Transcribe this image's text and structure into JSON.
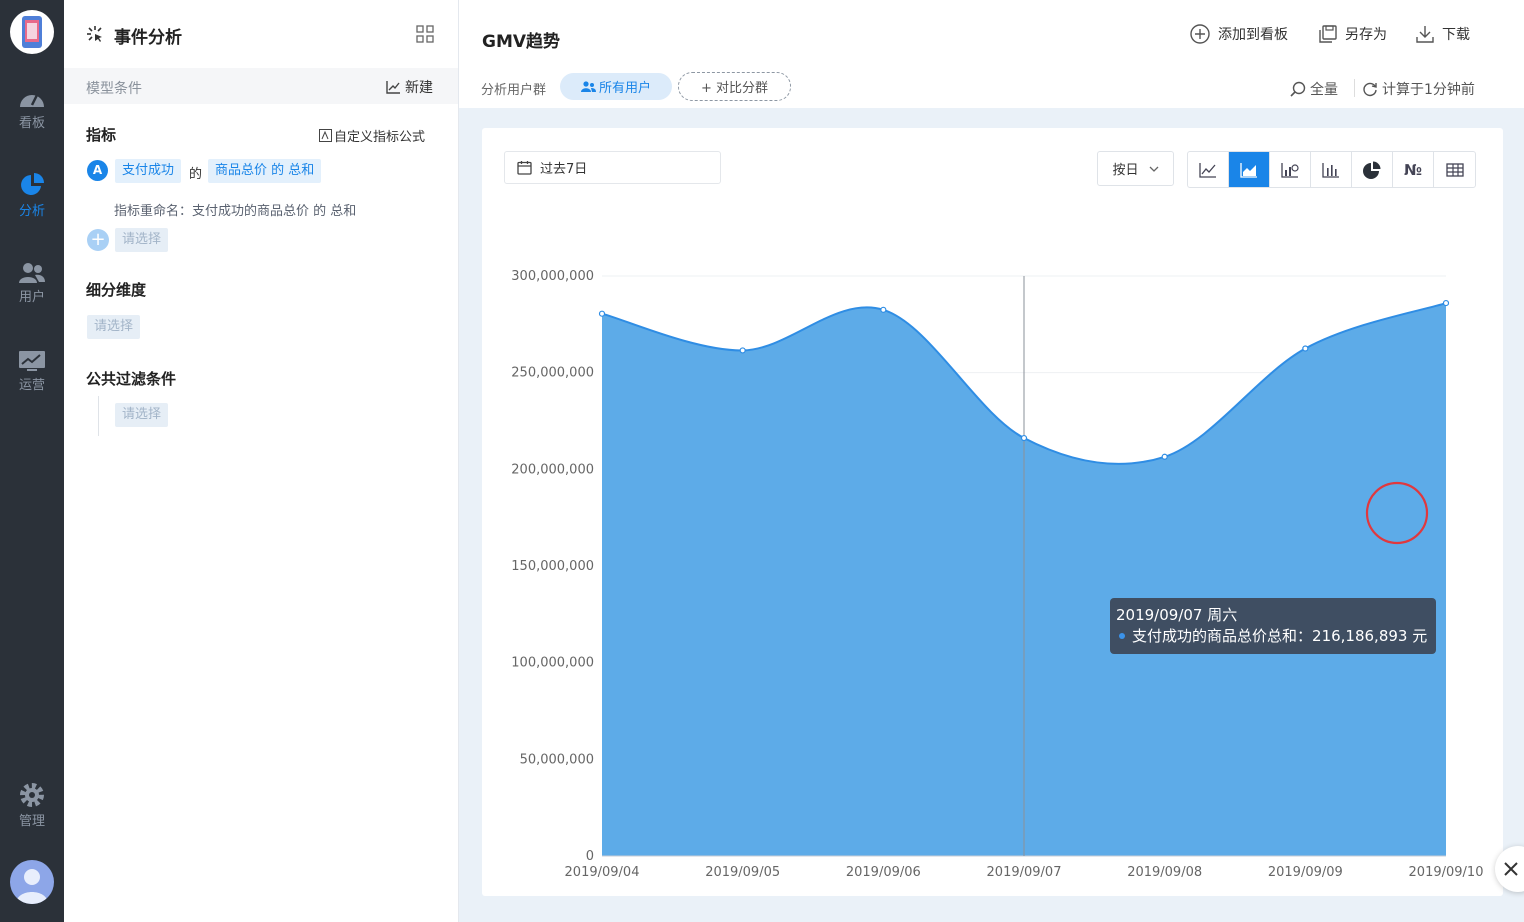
{
  "nav": {
    "items": [
      {
        "label": "看板",
        "icon": "dashboard-icon"
      },
      {
        "label": "分析",
        "icon": "pie-chart-icon",
        "active": true
      },
      {
        "label": "用户",
        "icon": "users-icon"
      },
      {
        "label": "运营",
        "icon": "monitor-chart-icon"
      },
      {
        "label": "管理",
        "icon": "gear-icon"
      }
    ]
  },
  "panel": {
    "title": "事件分析",
    "model_label": "模型条件",
    "new_label": "新建",
    "metrics_title": "指标",
    "custom_formula_label": "自定义指标公式",
    "metric": {
      "badge": "A",
      "event": "支付成功",
      "connector": "的",
      "property": "商品总价 的 总和",
      "rename": "指标重命名：支付成功的商品总价 的 总和"
    },
    "add_metric_placeholder": "请选择",
    "breakdown_title": "细分维度",
    "breakdown_placeholder": "请选择",
    "filter_title": "公共过滤条件",
    "filter_placeholder": "请选择"
  },
  "main": {
    "title": "GMV趋势",
    "actions": {
      "add_to_board": "添加到看板",
      "save_as": "另存为",
      "download": "下载"
    },
    "segment_label": "分析用户群",
    "segment_value": "所有用户",
    "compare_label": "+ 对比分群",
    "sampling_label": "全量",
    "computed_label": "计算于1分钟前",
    "date_range": "过去7日",
    "granularity": "按日",
    "chart_types": [
      "line",
      "area",
      "combo",
      "bar",
      "pie",
      "number",
      "table"
    ],
    "active_chart_type": "area",
    "accent_color": "#1a85e8"
  },
  "chart_data": {
    "type": "area",
    "categories": [
      "2019/09/04",
      "2019/09/05",
      "2019/09/06",
      "2019/09/07",
      "2019/09/08",
      "2019/09/09",
      "2019/09/10"
    ],
    "series": [
      {
        "name": "支付成功的商品总价总和",
        "values": [
          280500000,
          261500000,
          282500000,
          216186893,
          206500000,
          262500000,
          286000000
        ]
      }
    ],
    "y_ticks": [
      "0",
      "50,000,000",
      "100,000,000",
      "150,000,000",
      "200,000,000",
      "250,000,000",
      "300,000,000"
    ],
    "ylim": [
      0,
      300000000
    ],
    "grid": true,
    "fill_color": "#5dabe8",
    "line_color": "#2f8de4",
    "tooltip": {
      "date": "2019/09/07 周六",
      "label": "支付成功的商品总价总和",
      "value": "216,186,893 元"
    }
  }
}
